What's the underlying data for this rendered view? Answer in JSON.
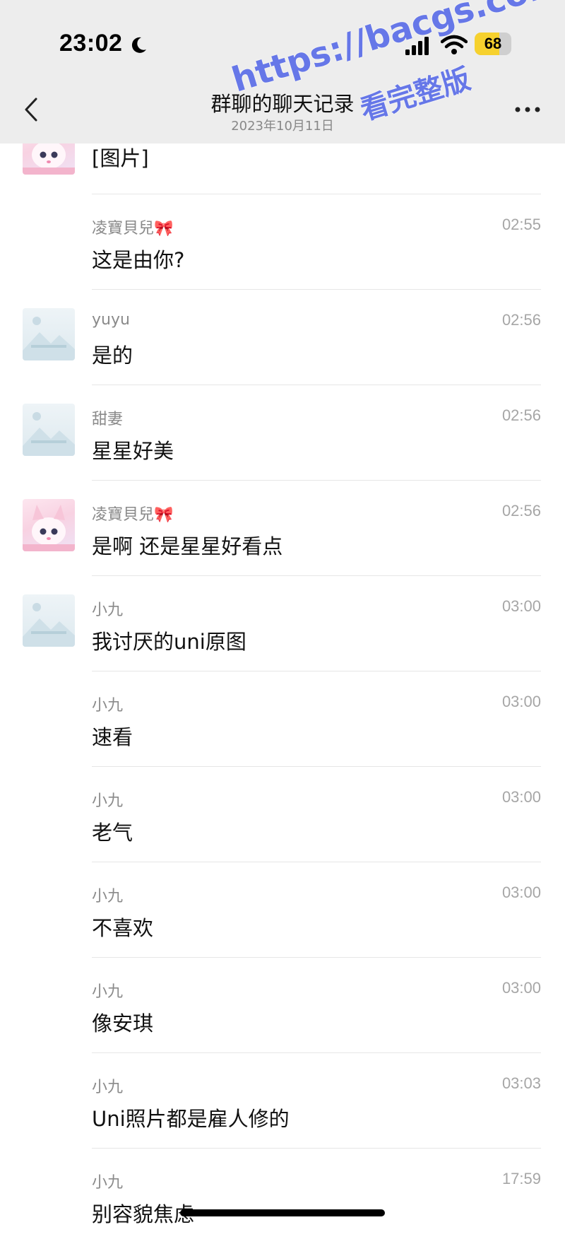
{
  "status_bar": {
    "time": "23:02",
    "battery": "68",
    "battery_level": 0.68,
    "icons": [
      "moon-icon",
      "signal-icon",
      "wifi-icon",
      "battery-icon"
    ]
  },
  "nav": {
    "title": "群聊的聊天记录",
    "subtitle": "2023年10月11日",
    "back_icon": "chevron-left-icon",
    "more_icon": "more-icon"
  },
  "watermark": {
    "url": "https://bacgs.com",
    "note": "看完整版"
  },
  "colors": {
    "topbar": "#ededed",
    "watermark": "#5b6ee8",
    "battery_fill": "#f6d12e",
    "sender": "#8a8a8a",
    "time": "#a6a6a6"
  },
  "messages": [
    {
      "sender": "",
      "time": "",
      "text": "[图片]",
      "avatar": "anime"
    },
    {
      "sender": "凌寶貝兒🎀",
      "time": "02:55",
      "text": "这是由你?",
      "avatar": ""
    },
    {
      "sender": "yuyu",
      "time": "02:56",
      "text": "是的",
      "avatar": "placeholder"
    },
    {
      "sender": "甜妻",
      "time": "02:56",
      "text": "星星好美",
      "avatar": "placeholder"
    },
    {
      "sender": "凌寶貝兒🎀",
      "time": "02:56",
      "text": "是啊 还是星星好看点",
      "avatar": "anime"
    },
    {
      "sender": "小九",
      "time": "03:00",
      "text": "我讨厌的uni原图",
      "avatar": "placeholder"
    },
    {
      "sender": "小九",
      "time": "03:00",
      "text": "速看",
      "avatar": ""
    },
    {
      "sender": "小九",
      "time": "03:00",
      "text": "老气",
      "avatar": ""
    },
    {
      "sender": "小九",
      "time": "03:00",
      "text": "不喜欢",
      "avatar": ""
    },
    {
      "sender": "小九",
      "time": "03:00",
      "text": "像安琪",
      "avatar": ""
    },
    {
      "sender": "小九",
      "time": "03:03",
      "text": "Uni照片都是雇人修的",
      "avatar": ""
    },
    {
      "sender": "小九",
      "time": "17:59",
      "text": "别容貌焦虑",
      "avatar": ""
    }
  ]
}
